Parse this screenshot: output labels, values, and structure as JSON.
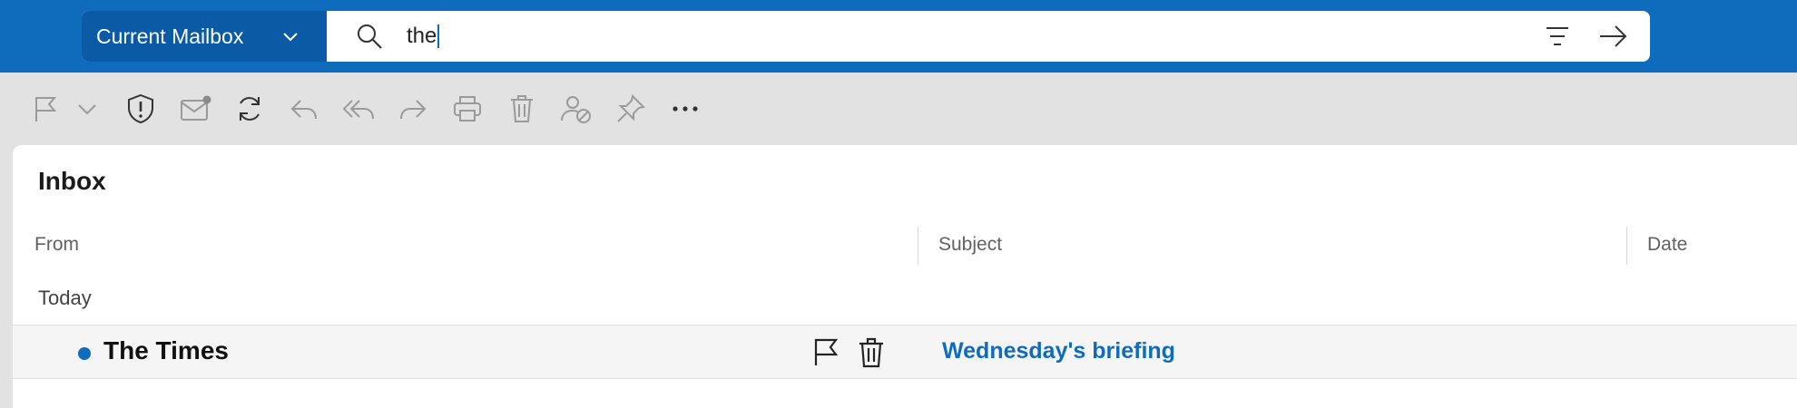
{
  "search": {
    "scope_label": "Current Mailbox",
    "query": "the"
  },
  "toolbar": {
    "buttons": [
      {
        "name": "flag-icon"
      },
      {
        "name": "chevron-down-icon"
      },
      {
        "name": "shield-icon"
      },
      {
        "name": "envelope-icon"
      },
      {
        "name": "sync-icon"
      },
      {
        "name": "reply-icon"
      },
      {
        "name": "reply-all-icon"
      },
      {
        "name": "forward-icon"
      },
      {
        "name": "print-icon"
      },
      {
        "name": "trash-icon"
      },
      {
        "name": "block-sender-icon"
      },
      {
        "name": "pin-icon"
      },
      {
        "name": "more-icon"
      }
    ]
  },
  "list": {
    "title": "Inbox",
    "columns": {
      "from": "From",
      "subject": "Subject",
      "date": "Date"
    },
    "groups": [
      {
        "label": "Today",
        "messages": [
          {
            "sender": "The Times",
            "subject": "Wednesday's briefing",
            "unread": true
          }
        ]
      }
    ]
  },
  "colors": {
    "brand": "#0f6cbd",
    "scope_bg": "#0b5aa6",
    "unread": "#0f6cbd"
  }
}
